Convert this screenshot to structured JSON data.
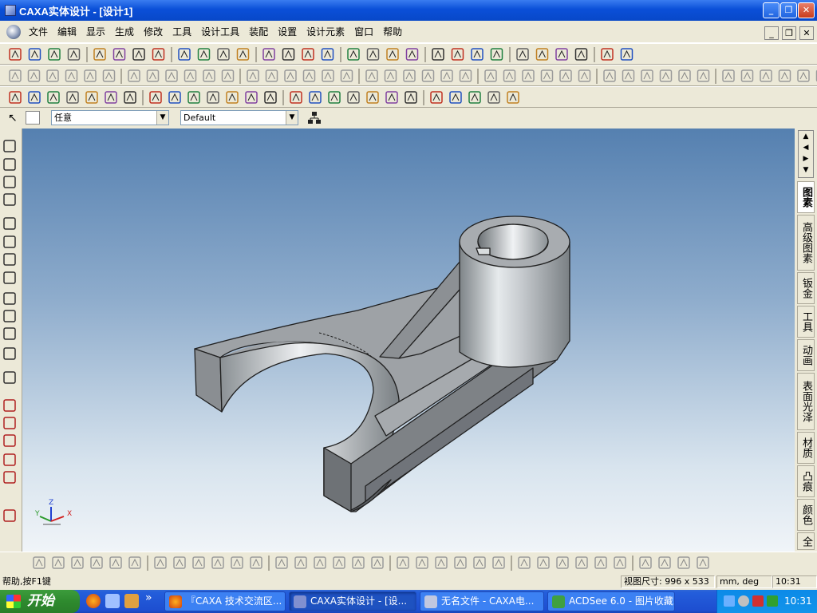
{
  "window": {
    "title": "CAXA实体设计 - [设计1]",
    "buttons": [
      "minimize",
      "restore",
      "close"
    ]
  },
  "menu": {
    "items": [
      "文件",
      "编辑",
      "显示",
      "生成",
      "修改",
      "工具",
      "设计工具",
      "装配",
      "设置",
      "设计元素",
      "窗口",
      "帮助"
    ]
  },
  "selection": {
    "filter_value": "任意",
    "style_value": "Default"
  },
  "right_tabs": [
    "图素",
    "高级图素",
    "钣金",
    "工具",
    "动画",
    "表面光泽",
    "材质",
    "凸痕",
    "颜色",
    "全"
  ],
  "viewport": {
    "axis_labels": {
      "x": "X",
      "y": "Y",
      "z": "Z"
    }
  },
  "status": {
    "help_text": "帮助,按F1键",
    "view_size_label": "视图尺寸: 996 x 533",
    "units": "mm, deg",
    "time": "10:31"
  },
  "taskbar": {
    "start_label": "开始",
    "quicklaunch_more": "»",
    "tasks": [
      {
        "label": "『CAXA 技术交流区...",
        "active": false
      },
      {
        "label": "CAXA实体设计 - [设...",
        "active": true
      },
      {
        "label": "无名文件 - CAXA电...",
        "active": false
      },
      {
        "label": "ACDSee 6.0 - 图片收藏",
        "active": false
      }
    ],
    "clock": "10:31"
  },
  "icons": {
    "toolbar1": [
      "new-icon",
      "new-drawing-icon",
      "open-icon",
      "save-icon",
      "undo-icon",
      "redo-icon",
      "cut-icon",
      "copy-icon",
      "paste-icon",
      "find-icon",
      "help-pointer-icon",
      "extrude-icon",
      "revolve-icon",
      "sweep-icon",
      "loft-icon",
      "text-icon",
      "section-icon",
      "move-icon",
      "scale-icon",
      "mirror-icon",
      "pattern-icon",
      "measure-icon",
      "link-icon",
      "smart-icon",
      "render-icon",
      "grid-icon",
      "table-icon",
      "fill-icon",
      "dropper-icon",
      "light-icon",
      "camera-icon"
    ],
    "left": [
      "pan-icon",
      "orbit-icon",
      "walk-icon",
      "fly-icon",
      "zoom-icon",
      "zoom-window-icon",
      "zoom-all-icon",
      "center-icon",
      "view-icon",
      "camera-icon",
      "light-icon",
      "render-icon",
      "sketch-icon",
      "plane-icon",
      "section-icon",
      "box-icon",
      "measure-icon",
      "material-icon",
      "text-icon"
    ]
  },
  "colors": {
    "titlebar": "#0a4fd8",
    "viewport_top": "#5580b0",
    "viewport_bottom": "#f0f4f8",
    "part": "#9aa0a4"
  }
}
